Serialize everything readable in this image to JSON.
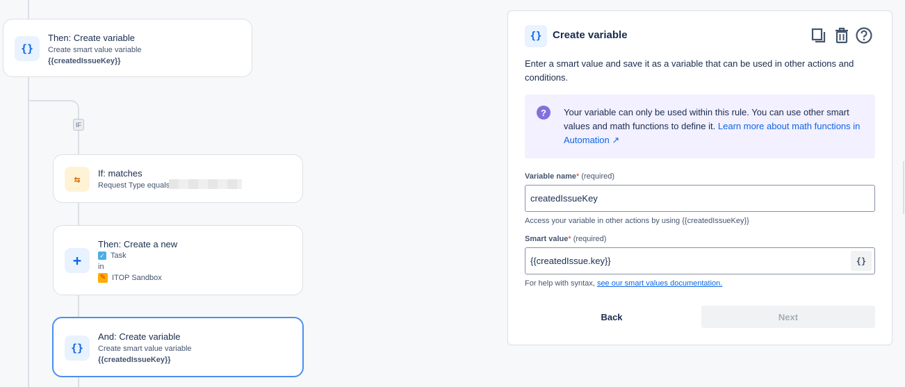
{
  "flow": {
    "if_badge": "IF",
    "cards": [
      {
        "title": "Then: Create variable",
        "sub": "Create smart value variable",
        "bold": "{{createdIssueKey}}",
        "icon": "braces-icon"
      },
      {
        "title": "If: matches",
        "sub": "Request Type equals",
        "icon": "branch-icon"
      },
      {
        "title": "Then: Create a new",
        "issue_type": "Task",
        "in": "in",
        "project": "ITOP Sandbox",
        "icon": "plus-icon"
      },
      {
        "title": "And: Create variable",
        "sub": "Create smart value variable",
        "bold": "{{createdIssueKey}}",
        "icon": "braces-icon"
      }
    ]
  },
  "panel": {
    "title": "Create variable",
    "description": "Enter a smart value and save it as a variable that can be used in other actions and conditions.",
    "info": {
      "text": "Your variable can only be used within this rule. You can use other smart values and math functions to define it.",
      "link": "Learn more about math functions in Automation ↗"
    },
    "variable_name": {
      "label": "Variable name",
      "required": "(required)",
      "value": "createdIssueKey",
      "help": "Access your variable in other actions by using {{createdIssueKey}}"
    },
    "smart_value": {
      "label": "Smart value",
      "required": "(required)",
      "value": "{{createdIssue.key}}",
      "help_prefix": "For help with syntax,",
      "help_link": "see our smart values documentation."
    },
    "buttons": {
      "back": "Back",
      "next": "Next"
    },
    "icons": {
      "copy": "copy-icon",
      "delete": "trash-icon",
      "help": "help-icon"
    }
  }
}
